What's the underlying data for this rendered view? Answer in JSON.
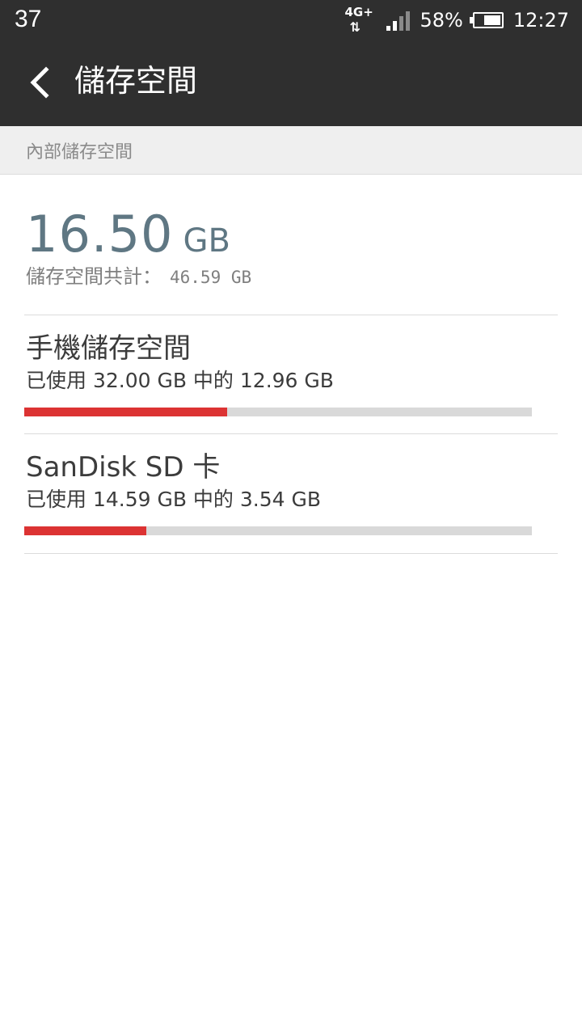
{
  "status_bar": {
    "left_text": "37",
    "network": "4G+",
    "network_arrows": "⇅",
    "battery_percent": "58%",
    "time": "12:27",
    "icons": [
      "network-4g-icon",
      "signal-icon",
      "battery-icon"
    ]
  },
  "header": {
    "title": "儲存空間",
    "back_icon": "chevron-left-icon"
  },
  "section": {
    "label": "內部儲存空間"
  },
  "summary": {
    "free_value": "16.50",
    "free_unit": "GB",
    "total_label": "儲存空間共計：",
    "total_value": "46.59 GB"
  },
  "storage_items": [
    {
      "title": "手機儲存空間",
      "usage_text": "已使用 32.00 GB 中的 12.96 GB",
      "used_fraction": 0.4
    },
    {
      "title": "SanDisk SD 卡",
      "usage_text": "已使用 14.59 GB 中的 3.54 GB",
      "used_fraction": 0.24
    }
  ],
  "colors": {
    "header_bg": "#2f2f2f",
    "accent_value": "#5f7783",
    "bar_used": "#dc3333",
    "bar_track": "#d9d9d9"
  }
}
